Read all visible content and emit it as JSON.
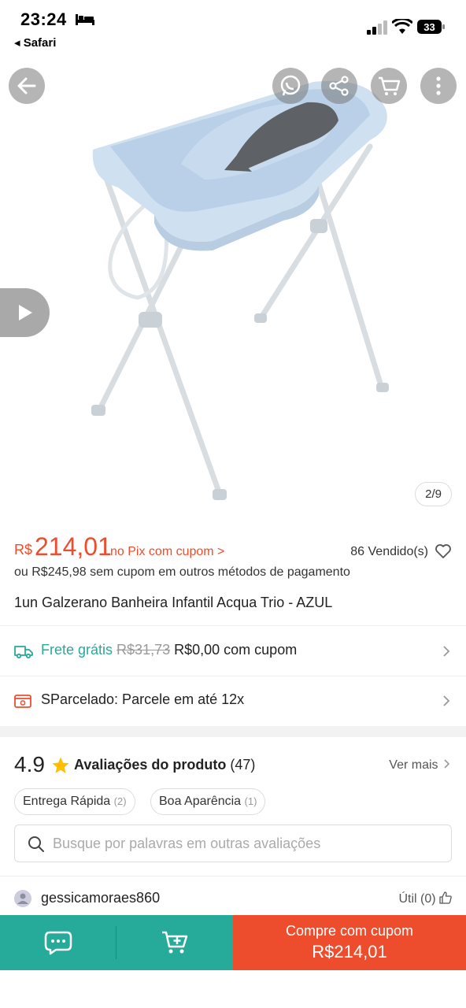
{
  "status": {
    "time": "23:24",
    "back_app": "◂ Safari",
    "battery": "33"
  },
  "gallery": {
    "counter": "2/9"
  },
  "price": {
    "currency": "R$",
    "value": "214,01",
    "pix_label": "no Pix com cupom >",
    "sold": "86 Vendido(s)",
    "alt_price": "ou R$245,98 sem cupom em outros métodos de pagamento"
  },
  "product": {
    "title": "1un Galzerano Banheira Infantil Acqua Trio - AZUL"
  },
  "shipping": {
    "label": "Frete grátis",
    "old_price": "R$31,73",
    "new_price": "R$0,00 com cupom"
  },
  "installments": {
    "label": "SParcelado: Parcele em até 12x"
  },
  "reviews": {
    "rating": "4.9",
    "title": "Avaliações do produto",
    "count": "(47)",
    "see_more": "Ver mais",
    "chips": [
      {
        "label": "Entrega Rápida",
        "count": "(2)"
      },
      {
        "label": "Boa Aparência",
        "count": "(1)"
      }
    ],
    "search_placeholder": "Busque por palavras em outras avaliações",
    "first_user": "gessicamoraes860",
    "helpful": "Útil (0)"
  },
  "bottom": {
    "buy_line1": "Compre com cupom",
    "buy_line2": "R$214,01"
  },
  "colors": {
    "accent": "#ee4d2d",
    "teal": "#26aa99"
  }
}
